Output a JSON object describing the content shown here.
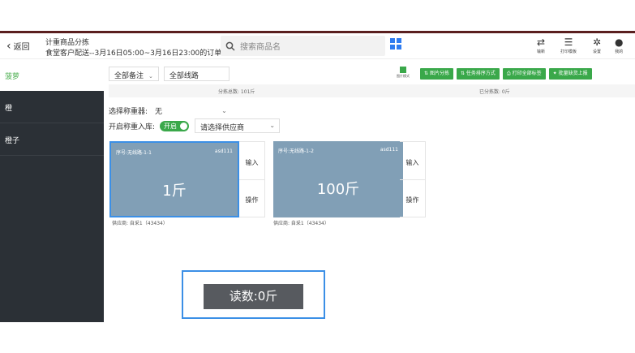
{
  "header": {
    "back_label": "返回",
    "title_line1": "计重商品分拣",
    "title_line2": "食堂客户配送--3月16日05:00~3月16日23:00的订单",
    "search_placeholder": "搜索商品名",
    "tools": [
      {
        "icon": "sync-icon",
        "glyph": "⇄",
        "label": "输新"
      },
      {
        "icon": "print-template-icon",
        "glyph": "☰",
        "label": "打印模板"
      },
      {
        "icon": "gear-icon",
        "glyph": "✲",
        "label": "设置"
      },
      {
        "icon": "user-icon",
        "glyph": "●",
        "label": "我的"
      }
    ]
  },
  "sidebar": {
    "items": [
      {
        "label": "菠萝",
        "active": true
      },
      {
        "label": "橙",
        "active": false
      },
      {
        "label": "橙子",
        "active": false
      }
    ]
  },
  "filters": {
    "remark": "全部备注",
    "route": "全部线路"
  },
  "actions": {
    "mini_label": "图片模式",
    "buttons": [
      "图片分拣",
      "任务排序方式",
      "打印全部标签",
      "批量缺货上报"
    ]
  },
  "summary": {
    "total": "分拣总数: 101斤",
    "done": "已分拣数: 0斤"
  },
  "scale": {
    "label": "选择称重器:",
    "value": "无"
  },
  "storage": {
    "label": "开启称重入库:",
    "toggle_text": "开启",
    "supplier_placeholder": "请选择供应商"
  },
  "cards": [
    {
      "seq": "序号:无线路-1-1",
      "code": "asd111",
      "weight": "1斤",
      "input": "输入",
      "op": "操作",
      "supplier": "供应商: 自采1（43434）"
    },
    {
      "seq": "序号:无线路-1-2",
      "code": "asd111",
      "weight": "100斤",
      "input": "输入",
      "op": "操作",
      "supplier": "供应商: 自采1（43434）"
    }
  ],
  "reading": "读数:0斤",
  "colors": {
    "accent_green": "#3aa84a",
    "sidebar_bg": "#2b3036",
    "card_bg": "#819fb6",
    "selection_blue": "#3b8fe6"
  }
}
